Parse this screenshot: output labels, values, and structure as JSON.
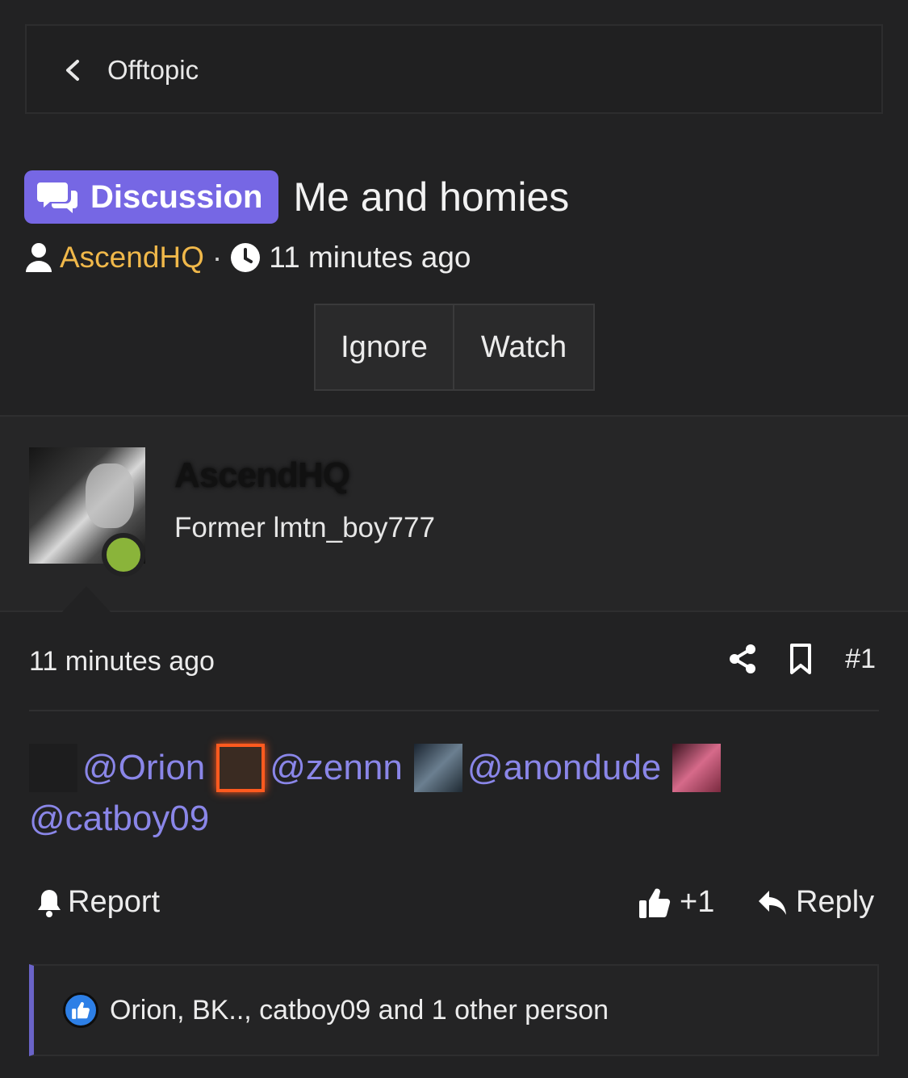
{
  "breadcrumb": {
    "label": "Offtopic"
  },
  "thread": {
    "prefix": "Discussion",
    "title": "Me and homies",
    "author": "AscendHQ",
    "separator": "·",
    "time": "11 minutes ago",
    "prefix_color": "#7667e4",
    "author_color": "#f0b84a"
  },
  "thread_buttons": {
    "ignore": "Ignore",
    "watch": "Watch"
  },
  "user": {
    "name": "AscendHQ",
    "title": "Former lmtn_boy777",
    "status": "online"
  },
  "post": {
    "time": "11 minutes ago",
    "number": "#1",
    "mentions": [
      "@Orion",
      "@zennn",
      "@anondude",
      "@catboy09"
    ],
    "mention_color": "#8a86e8"
  },
  "post_actions": {
    "report": "Report",
    "like_count": "+1",
    "reply": "Reply"
  },
  "reactions": {
    "text": "Orion, BK.., catboy09 and 1 other person"
  }
}
